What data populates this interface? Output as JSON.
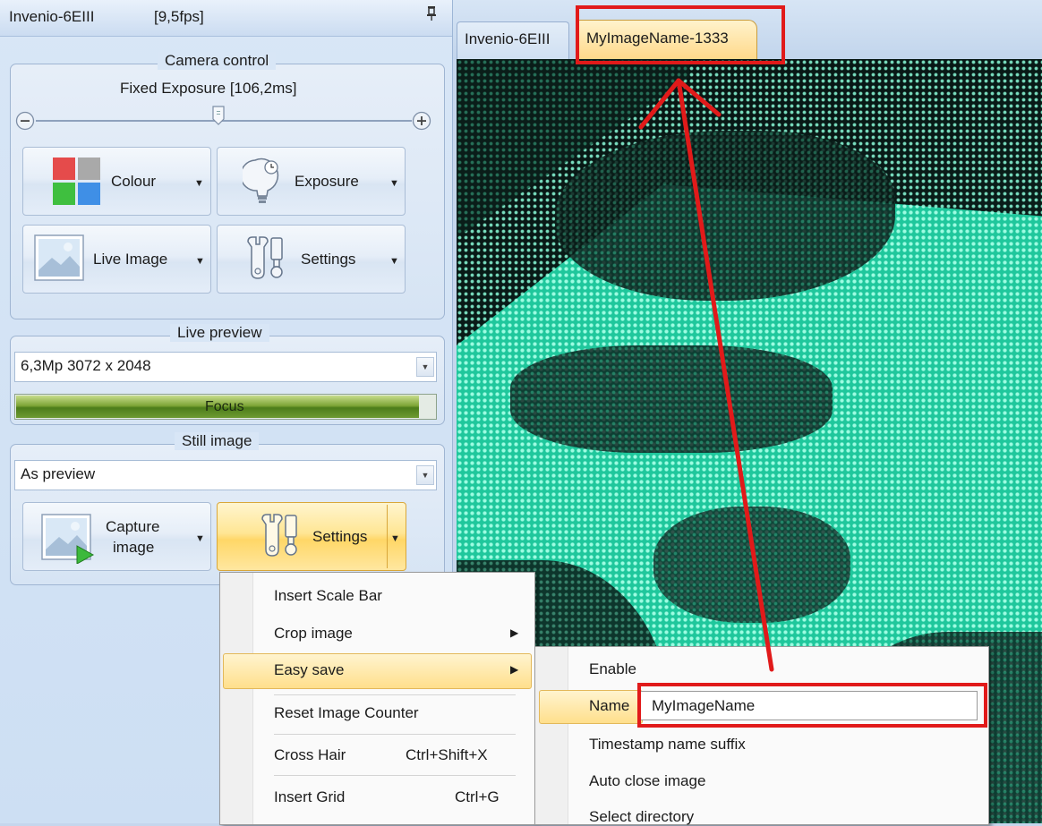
{
  "panel": {
    "title": "Invenio-6EIII",
    "fps": "[9,5fps]",
    "pin_icon": "pin-icon"
  },
  "camera_control": {
    "title": "Camera control",
    "exposure_label": "Fixed Exposure [106,2ms]",
    "minus_icon": "minus-circle-icon",
    "plus_icon": "plus-circle-icon",
    "colour_label": "Colour",
    "exposure_button_label": "Exposure",
    "live_image_label": "Live Image",
    "settings_label": "Settings"
  },
  "live_preview": {
    "title": "Live preview",
    "resolution": "6,3Mp 3072 x 2048",
    "focus_label": "Focus"
  },
  "still_image": {
    "title": "Still image",
    "resolution": "As preview",
    "capture_label_1": "Capture",
    "capture_label_2": "image",
    "settings_label": "Settings"
  },
  "tabs": [
    {
      "label": "Invenio-6EIII"
    },
    {
      "label": "MyImageName-1333"
    }
  ],
  "settings_menu": {
    "items": [
      {
        "label": "Insert Scale Bar"
      },
      {
        "label": "Crop image"
      },
      {
        "label": "Easy save"
      },
      {
        "label": "Reset Image Counter"
      },
      {
        "label": "Cross Hair",
        "shortcut": "Ctrl+Shift+X"
      },
      {
        "label": "Insert Grid",
        "shortcut": "Ctrl+G"
      }
    ]
  },
  "easy_save_menu": {
    "enable": "Enable",
    "name_label": "Name",
    "name_value": "MyImageName",
    "timestamp": "Timestamp name suffix",
    "auto_close": "Auto close image",
    "select_directory": "Select directory"
  },
  "colors": {
    "annotation": "#e11a1a",
    "highlight": "#ffdf8c",
    "panel": "#d8e6f6"
  }
}
